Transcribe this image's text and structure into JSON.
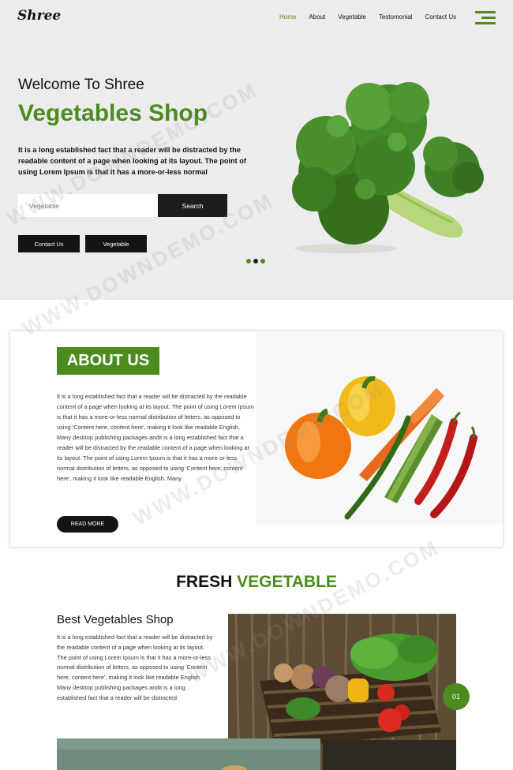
{
  "header": {
    "logo": "Shree",
    "nav": [
      {
        "label": "Home",
        "active": true
      },
      {
        "label": "About"
      },
      {
        "label": "Vegetable"
      },
      {
        "label": "Testomonial"
      },
      {
        "label": "Contact Us"
      }
    ]
  },
  "hero": {
    "subtitle": "Welcome To Shree",
    "title": "Vegetables Shop",
    "text": "It is a long established fact that a reader will be distracted by the readable content of a page when looking at its layout. The point of using Lorem Ipsum is that it has a more-or-less normal",
    "search_placeholder": "Vegetable",
    "search_button": "Search",
    "contact_button": "Contact Us",
    "vegetable_button": "Vegetable"
  },
  "about": {
    "title": "ABOUT US",
    "text": "It is a long established fact that a reader will be distracted by the readable content of a page when looking at its layout. The point of using Lorem Ipsum is that it has a more-or-less normal distribution of letters, as opposed to using 'Content here, content here', making it look like readable English. Many desktop publishing packages andit is a long established fact that a reader will be distracted by the readable content of a page when looking at its layout. The point of using Lorem Ipsum is that it has a more-or-less normal distribution of letters, as opposed to using 'Content here, content here', making it look like readable English. Many",
    "read_more": "READ MORE"
  },
  "fresh": {
    "title_dark": "FRESH",
    "title_green": "VEGETABLE",
    "card_title": "Best Vegetables Shop",
    "card_text": "It is a long established fact that a reader will be distracted by the readable content of a page when looking at its layout. The point of using Lorem Ipsum is that it has a more-or-less normal distribution of letters, as opposed to using 'Content here, content here', making it look like readable English. Many desktop publishing packages andit is a long established fact that a reader will be distracted",
    "badge": "01"
  },
  "watermark": "WWW.DOWNDEMO.COM",
  "colors": {
    "accent": "#4c8b1d",
    "dark": "#141414",
    "hero_bg": "#ececee"
  }
}
